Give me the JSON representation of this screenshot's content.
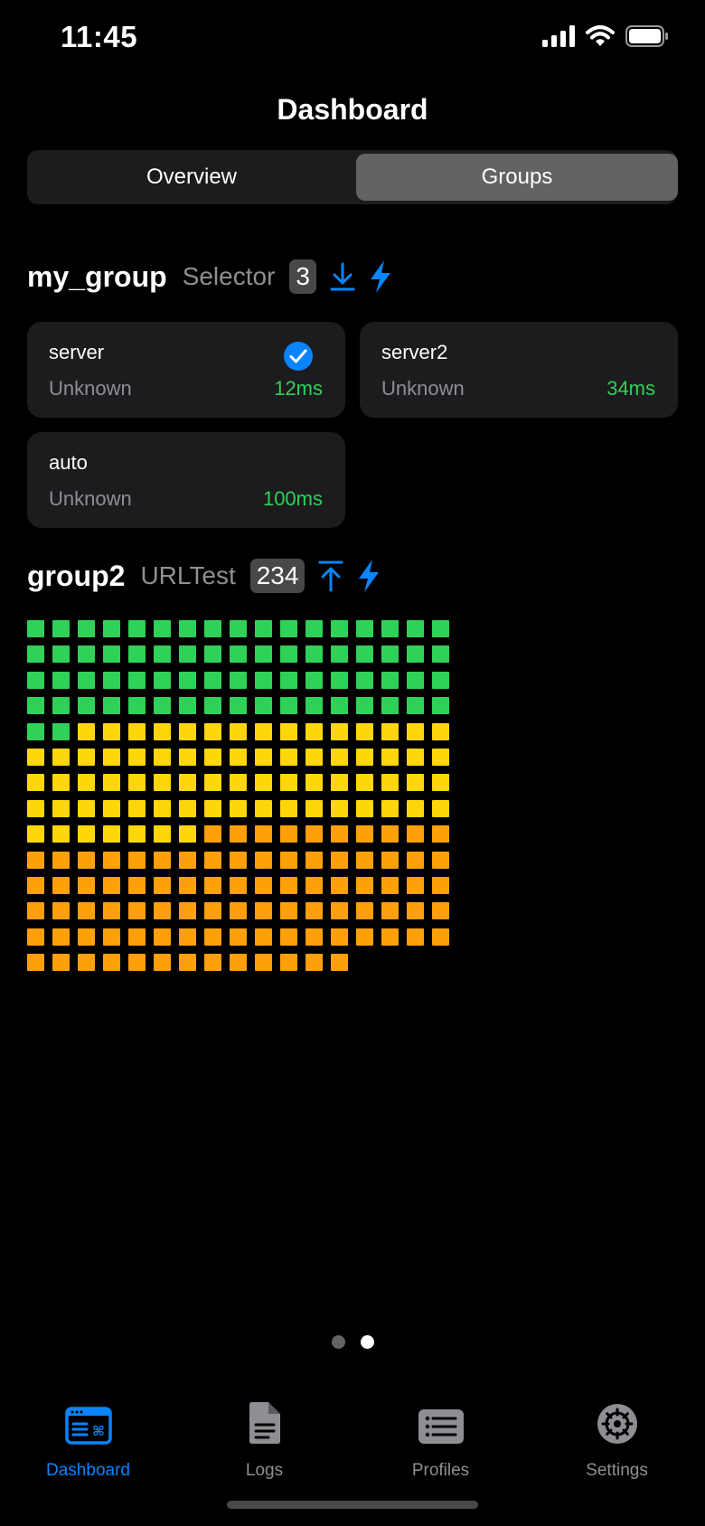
{
  "status": {
    "time": "11:45"
  },
  "title": "Dashboard",
  "segments": {
    "overview": "Overview",
    "groups": "Groups",
    "selected": "Groups"
  },
  "groups": [
    {
      "name": "my_group",
      "type": "Selector",
      "count": "3",
      "sort_icon": "arrow-down-to-line-icon",
      "test_icon": "bolt-icon",
      "proxies": [
        {
          "name": "server",
          "status": "Unknown",
          "latency": "12ms",
          "selected": true
        },
        {
          "name": "server2",
          "status": "Unknown",
          "latency": "34ms",
          "selected": false
        },
        {
          "name": "auto",
          "status": "Unknown",
          "latency": "100ms",
          "selected": false
        }
      ]
    },
    {
      "name": "group2",
      "type": "URLTest",
      "count": "234",
      "sort_icon": "arrow-up-to-line-icon",
      "test_icon": "bolt-icon",
      "latency_grid": {
        "columns": 17,
        "green": 70,
        "yellow": 73,
        "orange": 91
      }
    }
  ],
  "page_indicator": {
    "pages": 2,
    "current": 2
  },
  "tabs": [
    {
      "label": "Dashboard",
      "icon": "dashboard-icon",
      "active": true
    },
    {
      "label": "Logs",
      "icon": "doc-text-icon",
      "active": false
    },
    {
      "label": "Profiles",
      "icon": "list-rectangle-icon",
      "active": false
    },
    {
      "label": "Settings",
      "icon": "gear-icon",
      "active": false
    }
  ],
  "colors": {
    "accent": "#0a84ff",
    "green": "#30d158",
    "yellow": "#ffd60a",
    "orange": "#ff9f0a"
  }
}
